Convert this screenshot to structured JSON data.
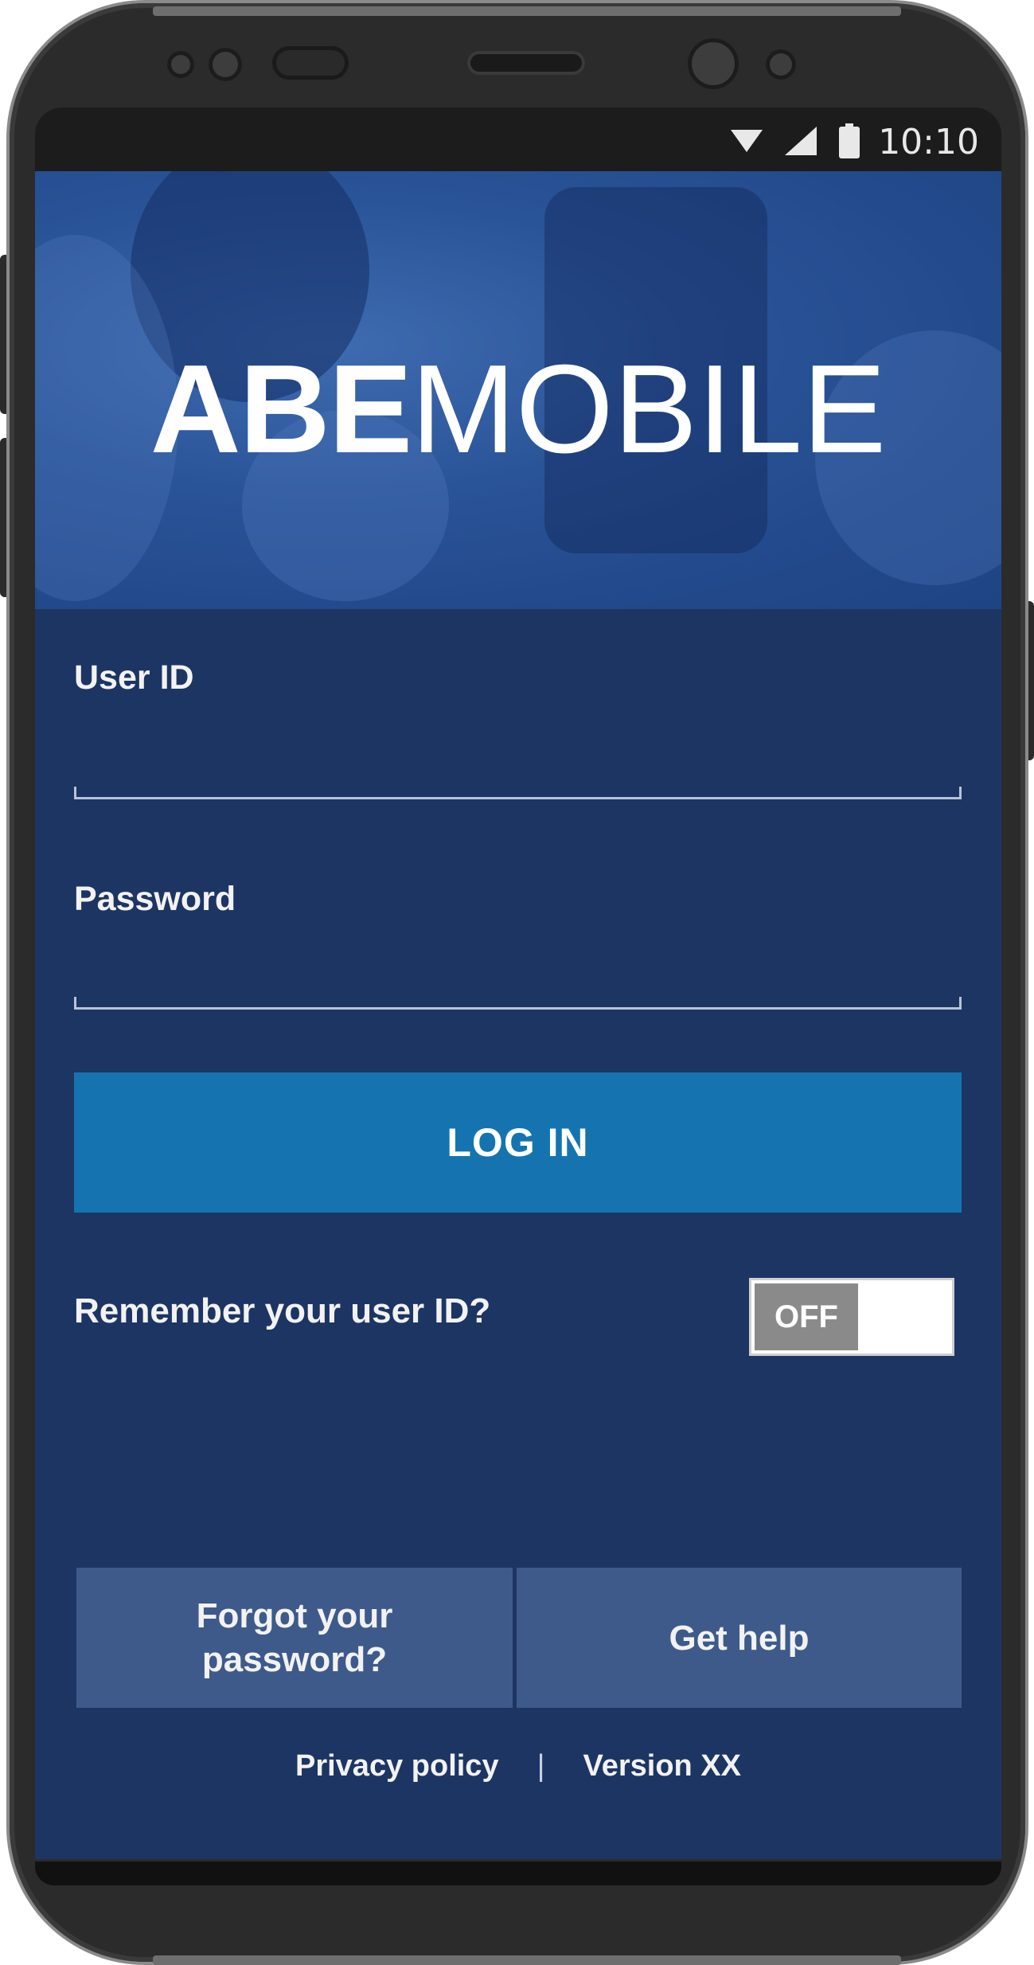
{
  "status_bar": {
    "time": "10:10"
  },
  "hero": {
    "logo_bold": "ABE",
    "logo_light": "MOBILE"
  },
  "form": {
    "user_id_label": "User ID",
    "user_id_value": "",
    "password_label": "Password",
    "password_value": "",
    "login_label": "LOG IN"
  },
  "remember": {
    "label": "Remember your user ID?",
    "toggle_state": "OFF"
  },
  "help": {
    "forgot_line1": "Forgot your",
    "forgot_line2": "password?",
    "get_help": "Get help"
  },
  "footer": {
    "privacy": "Privacy policy",
    "separator": "|",
    "version": "Version XX"
  },
  "colors": {
    "background": "#1d3563",
    "button": "#1574b0",
    "help_box": "#3e5a8a",
    "hero": "#2a5498"
  }
}
